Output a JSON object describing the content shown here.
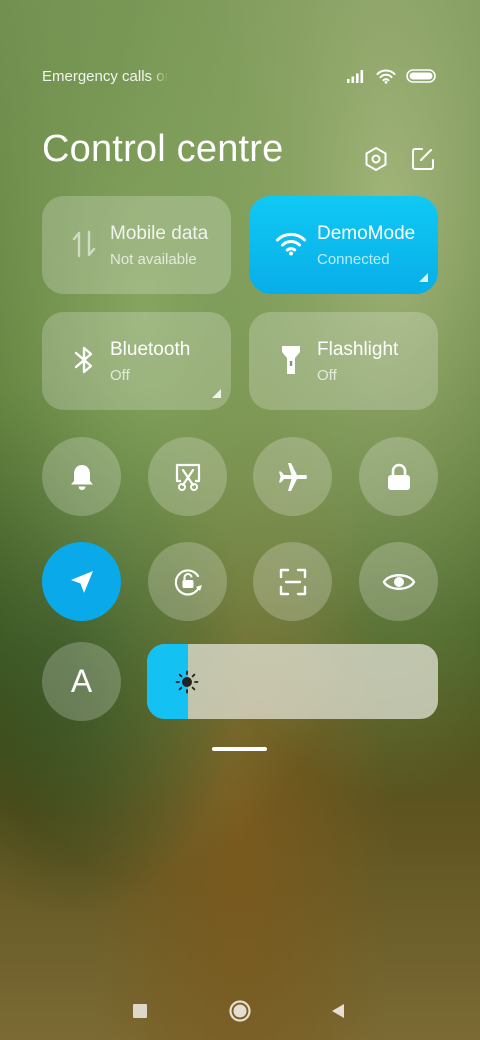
{
  "status_bar": {
    "text": "Emergency calls only"
  },
  "header": {
    "title": "Control centre"
  },
  "tiles": [
    {
      "label": "Mobile data",
      "sublabel": "Not available"
    },
    {
      "label": "DemoMode",
      "sublabel": "Connected"
    },
    {
      "label": "Bluetooth",
      "sublabel": "Off"
    },
    {
      "label": "Flashlight",
      "sublabel": "Off"
    }
  ],
  "round_toggles": [
    {
      "icon": "bell-icon",
      "active": false
    },
    {
      "icon": "screenshot-icon",
      "active": false
    },
    {
      "icon": "airplane-icon",
      "active": false
    },
    {
      "icon": "lock-icon",
      "active": false
    },
    {
      "icon": "location-icon",
      "active": true
    },
    {
      "icon": "rotation-lock-icon",
      "active": false
    },
    {
      "icon": "scanner-icon",
      "active": false
    },
    {
      "icon": "eye-icon",
      "active": false
    },
    {
      "icon": "auto-brightness-icon",
      "active": false,
      "label": "A"
    }
  ],
  "brightness": {
    "level_percent": 14
  },
  "colors": {
    "accent": "#08AEE8",
    "tile_bg": "rgba(255,255,255,0.22)"
  }
}
